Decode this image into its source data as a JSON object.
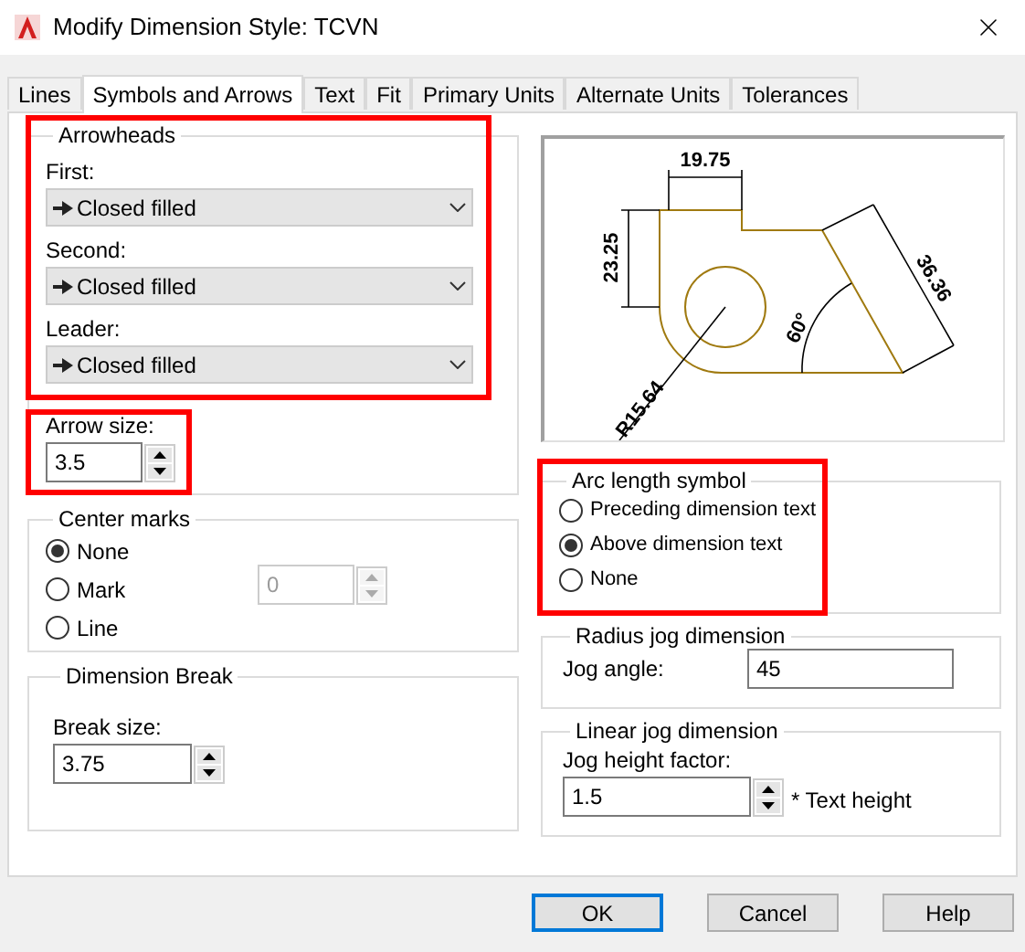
{
  "window": {
    "title": "Modify Dimension Style: TCVN"
  },
  "tabs": [
    {
      "label": "Lines",
      "selected": false
    },
    {
      "label": "Symbols and Arrows",
      "selected": true
    },
    {
      "label": "Text",
      "selected": false
    },
    {
      "label": "Fit",
      "selected": false
    },
    {
      "label": "Primary Units",
      "selected": false
    },
    {
      "label": "Alternate Units",
      "selected": false
    },
    {
      "label": "Tolerances",
      "selected": false
    }
  ],
  "arrowheads": {
    "legend": "Arrowheads",
    "fields": [
      {
        "label": "First:",
        "value": "Closed filled"
      },
      {
        "label": "Second:",
        "value": "Closed filled"
      },
      {
        "label": "Leader:",
        "value": "Closed filled"
      }
    ],
    "arrow_size": {
      "label": "Arrow size:",
      "value": "3.5"
    }
  },
  "center_marks": {
    "legend": "Center marks",
    "options": [
      {
        "label": "None",
        "selected": true
      },
      {
        "label": "Mark",
        "selected": false
      },
      {
        "label": "Line",
        "selected": false
      }
    ],
    "size": {
      "value": "0",
      "disabled": true
    }
  },
  "dimension_break": {
    "legend": "Dimension Break",
    "break_size": {
      "label": "Break size:",
      "value": "3.75"
    }
  },
  "preview": {
    "labels": [
      "19.75",
      "23.25",
      "R15.64",
      "60°",
      "36.36"
    ]
  },
  "arc_length_symbol": {
    "legend": "Arc length symbol",
    "options": [
      {
        "label": "Preceding dimension text",
        "selected": false
      },
      {
        "label": "Above dimension text",
        "selected": true
      },
      {
        "label": "None",
        "selected": false
      }
    ]
  },
  "radius_jog": {
    "legend": "Radius jog dimension",
    "jog_angle": {
      "label": "Jog angle:",
      "value": "45"
    }
  },
  "linear_jog": {
    "legend": "Linear jog dimension",
    "jog_height_factor": {
      "label": "Jog height factor:",
      "value": "1.5",
      "suffix": "* Text height"
    }
  },
  "buttons": [
    {
      "label": "OK",
      "default": true
    },
    {
      "label": "Cancel",
      "default": false
    },
    {
      "label": "Help",
      "default": false
    }
  ]
}
